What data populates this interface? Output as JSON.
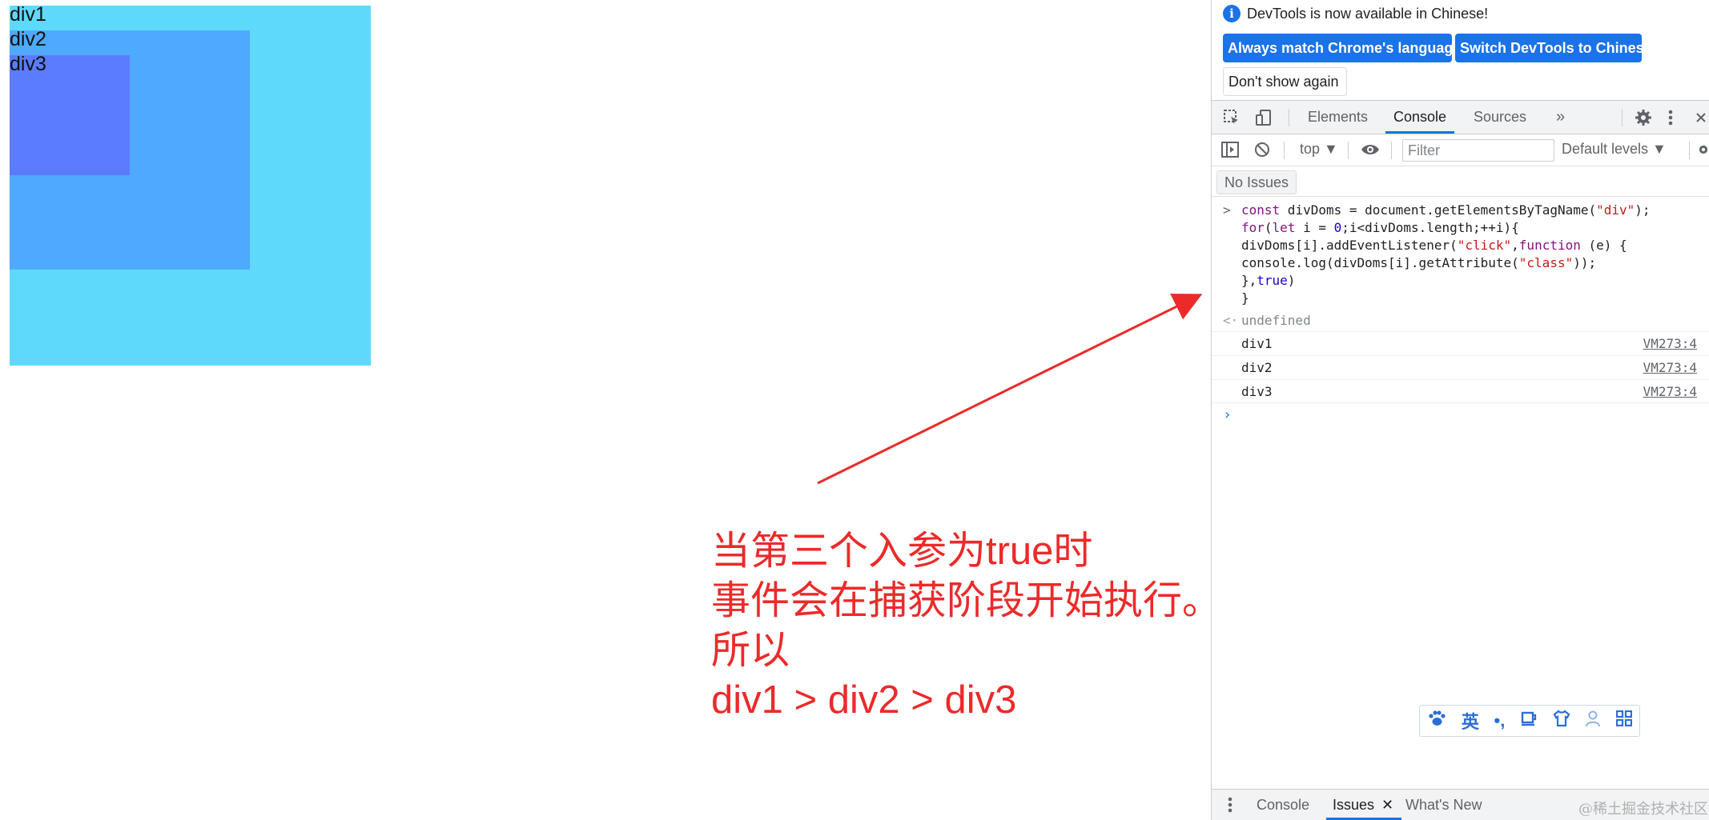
{
  "page": {
    "boxes": [
      {
        "label": "div1"
      },
      {
        "label": "div2"
      },
      {
        "label": "div3"
      }
    ],
    "annotation_lines": [
      "当第三个入参为true时",
      "事件会在捕获阶段开始执行。",
      "所以",
      "div1 > div2 > div3"
    ]
  },
  "devtools": {
    "infobar": {
      "message": "DevTools is now available in Chinese!",
      "match_button": "Always match Chrome's language",
      "switch_button": "Switch DevTools to Chinese",
      "dont_show_button": "Don't show again"
    },
    "tabs": [
      {
        "label": "Elements"
      },
      {
        "label": "Console"
      },
      {
        "label": "Sources"
      }
    ],
    "more_tabs_icon": "»",
    "toolbar": {
      "context": "top ▼",
      "filter_placeholder": "Filter",
      "levels": "Default levels ▼"
    },
    "issues_badge": "No Issues",
    "console": {
      "code_lines": [
        "const divDoms = document.getElementsByTagName(\"div\");",
        "for(let i = 0;i<divDoms.length;++i){",
        "divDoms[i].addEventListener(\"click\",function (e) {",
        "console.log(divDoms[i].getAttribute(\"class\"));",
        "},true)",
        "}"
      ],
      "result": "undefined",
      "logs": [
        {
          "text": "div1",
          "source": "VM273:4"
        },
        {
          "text": "div2",
          "source": "VM273:4"
        },
        {
          "text": "div3",
          "source": "VM273:4"
        }
      ]
    },
    "ime_icons": [
      "paw-icon",
      "英",
      "punctuation-icon",
      "cup-icon",
      "shirt-icon",
      "user-icon",
      "grid-icon"
    ],
    "ime_label": "英",
    "drawer": {
      "tabs": [
        {
          "label": "Console"
        },
        {
          "label": "Issues"
        },
        {
          "label": "What's New"
        }
      ],
      "close_glyph": "✕"
    },
    "watermark": "@稀土掘金技术社区"
  },
  "colors": {
    "div1": "#5fd9fb",
    "div2": "#4ea9ff",
    "div3": "#5b7cff",
    "annotation": "#ec2a2a",
    "accent": "#1a73e8"
  }
}
